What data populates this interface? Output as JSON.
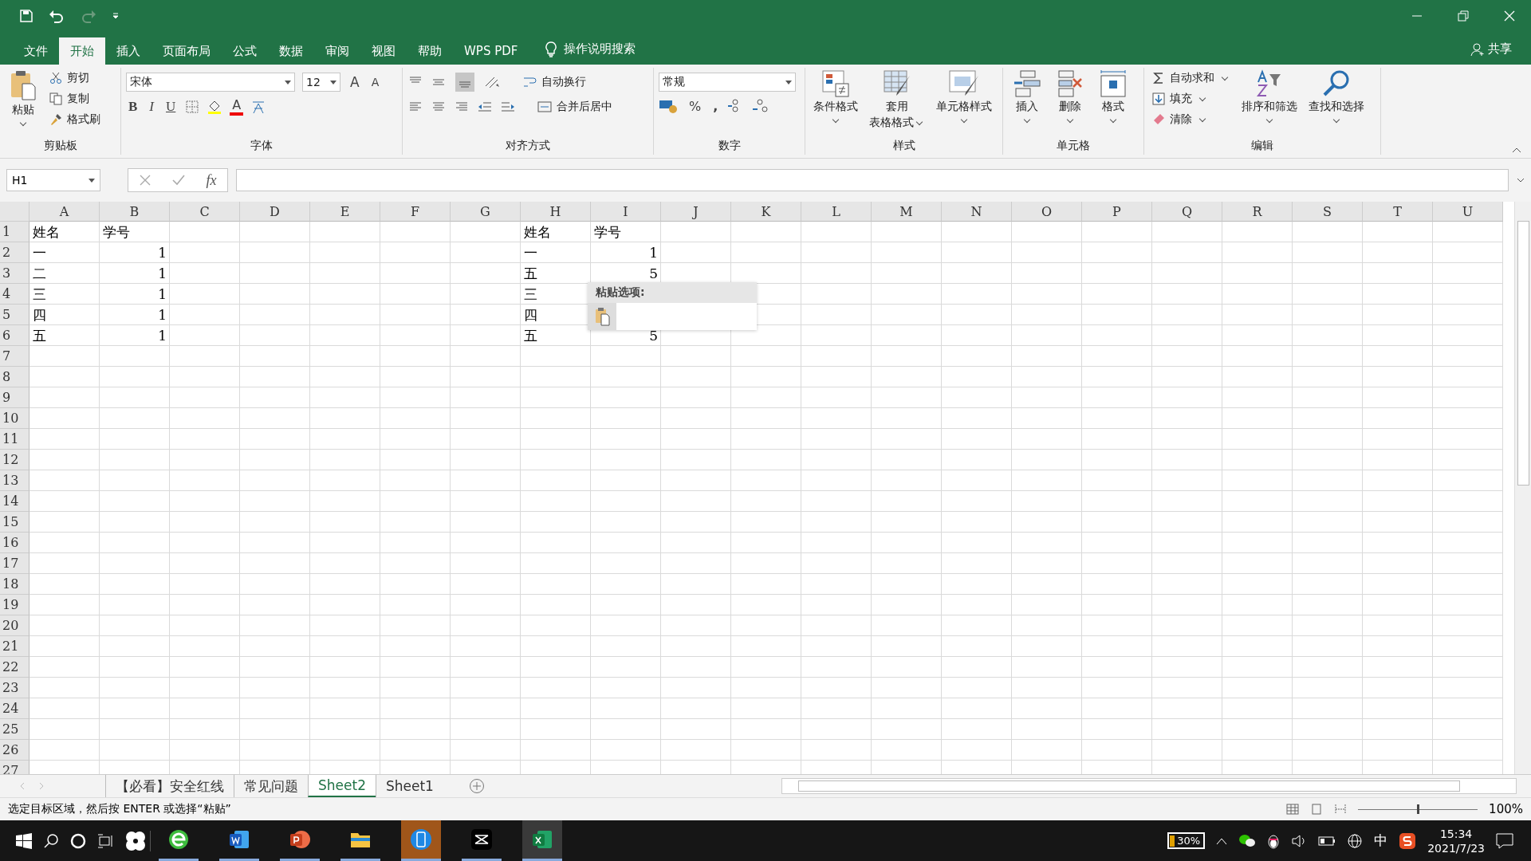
{
  "menu_tabs": [
    {
      "label": "文件",
      "selected": false
    },
    {
      "label": "开始",
      "selected": true
    },
    {
      "label": "插入",
      "selected": false
    },
    {
      "label": "页面布局",
      "selected": false
    },
    {
      "label": "公式",
      "selected": false
    },
    {
      "label": "数据",
      "selected": false
    },
    {
      "label": "审阅",
      "selected": false
    },
    {
      "label": "视图",
      "selected": false
    },
    {
      "label": "帮助",
      "selected": false
    },
    {
      "label": "WPS PDF",
      "selected": false
    }
  ],
  "tell_me": "操作说明搜索",
  "share": "共享",
  "ribbon": {
    "clipboard": {
      "label": "剪贴板",
      "paste": "粘贴",
      "cut": "剪切",
      "copy": "复制",
      "format_painter": "格式刷"
    },
    "font": {
      "label": "字体",
      "font_name": "宋体",
      "font_size": "12",
      "grow": "A",
      "shrink": "A",
      "bold": "B",
      "italic": "I",
      "underline": "U",
      "font_color": "A"
    },
    "alignment": {
      "label": "对齐方式",
      "wrap_text": "自动换行",
      "merge_center": "合并后居中"
    },
    "number": {
      "label": "数字",
      "format": "常规",
      "percent": "%",
      "comma": ","
    },
    "styles": {
      "label": "样式",
      "conditional": "条件格式",
      "table_line1": "套用",
      "table_line2": "表格格式",
      "cell_styles": "单元格样式"
    },
    "cells": {
      "label": "单元格",
      "insert": "插入",
      "delete": "删除",
      "format": "格式"
    },
    "editing": {
      "label": "编辑",
      "autosum": "自动求和",
      "fill": "填充",
      "clear": "清除",
      "sort_filter": "排序和筛选",
      "find_select": "查找和选择"
    }
  },
  "formula_bar": {
    "name_box": "H1",
    "fx": "fx"
  },
  "sheet": {
    "columns": [
      "A",
      "B",
      "C",
      "D",
      "E",
      "F",
      "G",
      "H",
      "I",
      "J",
      "K",
      "L",
      "M",
      "N",
      "O",
      "P",
      "Q",
      "R",
      "S",
      "T",
      "U"
    ],
    "rows": [
      {
        "number": "1",
        "cells": {
          "A": {
            "text": "姓名",
            "kind": "text"
          },
          "B": {
            "text": "学号",
            "kind": "text"
          },
          "H": {
            "text": "姓名",
            "kind": "text"
          },
          "I": {
            "text": "学号",
            "kind": "text"
          }
        }
      },
      {
        "number": "2",
        "cells": {
          "A": {
            "text": "一",
            "kind": "text"
          },
          "B": {
            "text": "1",
            "kind": "number"
          },
          "H": {
            "text": "一",
            "kind": "text"
          },
          "I": {
            "text": "1",
            "kind": "number"
          }
        }
      },
      {
        "number": "3",
        "cells": {
          "A": {
            "text": "二",
            "kind": "text"
          },
          "B": {
            "text": "1",
            "kind": "number"
          },
          "H": {
            "text": "五",
            "kind": "text"
          },
          "I": {
            "text": "5",
            "kind": "number"
          }
        }
      },
      {
        "number": "4",
        "cells": {
          "A": {
            "text": "三",
            "kind": "text"
          },
          "B": {
            "text": "1",
            "kind": "number"
          },
          "H": {
            "text": "三",
            "kind": "text"
          }
        }
      },
      {
        "number": "5",
        "cells": {
          "A": {
            "text": "四",
            "kind": "text"
          },
          "B": {
            "text": "1",
            "kind": "number"
          },
          "H": {
            "text": "四",
            "kind": "text"
          }
        }
      },
      {
        "number": "6",
        "cells": {
          "A": {
            "text": "五",
            "kind": "text"
          },
          "B": {
            "text": "1",
            "kind": "number"
          },
          "H": {
            "text": "五",
            "kind": "text"
          },
          "I": {
            "text": "5",
            "kind": "number"
          }
        }
      },
      {
        "number": "7"
      },
      {
        "number": "8"
      },
      {
        "number": "9"
      },
      {
        "number": "10"
      },
      {
        "number": "11"
      },
      {
        "number": "12"
      },
      {
        "number": "13"
      },
      {
        "number": "14"
      },
      {
        "number": "15"
      },
      {
        "number": "16"
      },
      {
        "number": "17"
      },
      {
        "number": "18"
      },
      {
        "number": "19"
      },
      {
        "number": "20"
      },
      {
        "number": "21"
      },
      {
        "number": "22"
      },
      {
        "number": "23"
      },
      {
        "number": "24"
      },
      {
        "number": "25"
      },
      {
        "number": "26"
      },
      {
        "number": "27"
      }
    ]
  },
  "paste_popup": {
    "title": "粘贴选项:"
  },
  "sheet_tabs": [
    {
      "label": "【必看】安全红线",
      "selected": false
    },
    {
      "label": "常见问题",
      "selected": false
    },
    {
      "label": "Sheet2",
      "selected": true
    },
    {
      "label": "Sheet1",
      "selected": false
    }
  ],
  "status_bar": {
    "message": "选定目标区域，然后按 ENTER 或选择“粘贴”",
    "zoom_slider": {
      "level": 0.5
    },
    "zoom": "100%"
  },
  "taskbar": {
    "battery": "30%",
    "ime": "中",
    "time": "15:34",
    "date": "2021/7/23"
  }
}
